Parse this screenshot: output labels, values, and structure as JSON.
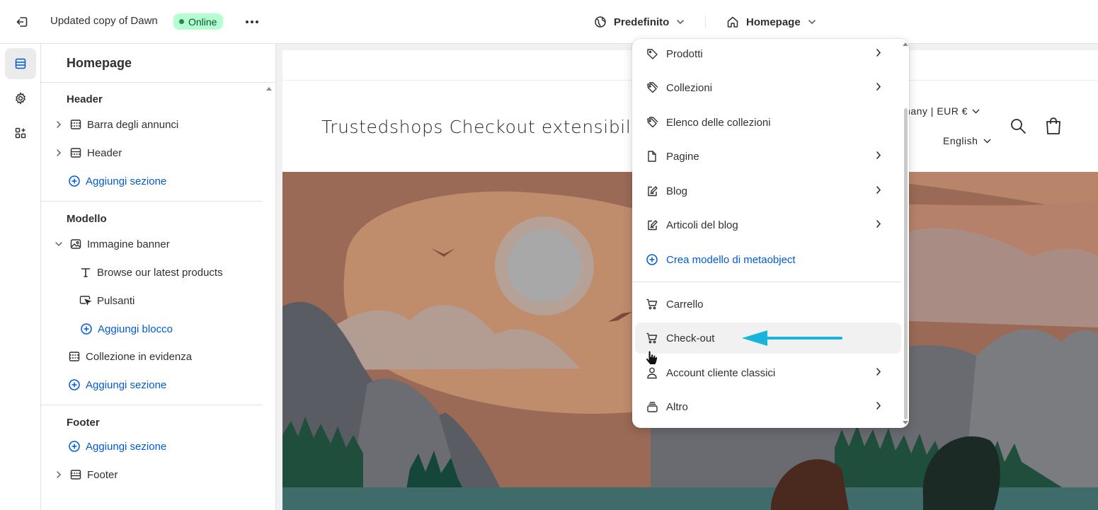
{
  "topbar": {
    "exit_icon": "exit-icon",
    "theme_name": "Updated copy of Dawn",
    "status_badge": "Online",
    "more_icon": "more-horizontal-icon",
    "template_select": "Predefinito",
    "page_select": "Homepage"
  },
  "rail": {
    "items": [
      {
        "icon": "sections-icon",
        "active": true
      },
      {
        "icon": "gear-icon",
        "active": false
      },
      {
        "icon": "apps-icon",
        "active": false
      }
    ]
  },
  "sidebar": {
    "title": "Homepage",
    "header_group": {
      "heading": "Header",
      "items": [
        "Barra degli annunci",
        "Header"
      ],
      "add_label": "Aggiungi sezione"
    },
    "template_group": {
      "heading": "Modello",
      "banner": "Immagine banner",
      "blocks": [
        "Browse our latest products",
        "Pulsanti"
      ],
      "add_block_label": "Aggiungi blocco",
      "collection": "Collezione in evidenza",
      "add_label": "Aggiungi sezione"
    },
    "footer_group": {
      "heading": "Footer",
      "add_label": "Aggiungi sezione",
      "item": "Footer"
    }
  },
  "preview": {
    "store_name": "Trustedshops Checkout extensibility",
    "country_selector": "rmany | EUR €",
    "language_selector": "English",
    "colors": {
      "sky": "#9a6a56",
      "sun": "#a8a8a8",
      "water": "#3f6b6b",
      "forest": "#1f4e3d"
    }
  },
  "dropdown": {
    "items": [
      {
        "label": "Prodotti",
        "icon": "tag-icon",
        "has_submenu": true
      },
      {
        "label": "Collezioni",
        "icon": "tags-icon",
        "has_submenu": true
      },
      {
        "label": "Elenco delle collezioni",
        "icon": "tags-icon",
        "has_submenu": false
      },
      {
        "label": "Pagine",
        "icon": "page-icon",
        "has_submenu": true
      },
      {
        "label": "Blog",
        "icon": "blog-icon",
        "has_submenu": true
      },
      {
        "label": "Articoli del blog",
        "icon": "blog-icon",
        "has_submenu": true
      },
      {
        "label": "Crea modello di metaobject",
        "icon": "plus-circle-icon",
        "has_submenu": false
      },
      {
        "label": "Carrello",
        "icon": "cart-icon",
        "has_submenu": false
      },
      {
        "label": "Check-out",
        "icon": "cart-icon",
        "has_submenu": false,
        "highlighted": true
      },
      {
        "label": "Account cliente classici",
        "icon": "person-icon",
        "has_submenu": true
      },
      {
        "label": "Altro",
        "icon": "layers-icon",
        "has_submenu": true
      }
    ]
  },
  "annotation": {
    "arrow_color": "#18b4dc",
    "arrow_icon": "arrow-left-icon"
  }
}
